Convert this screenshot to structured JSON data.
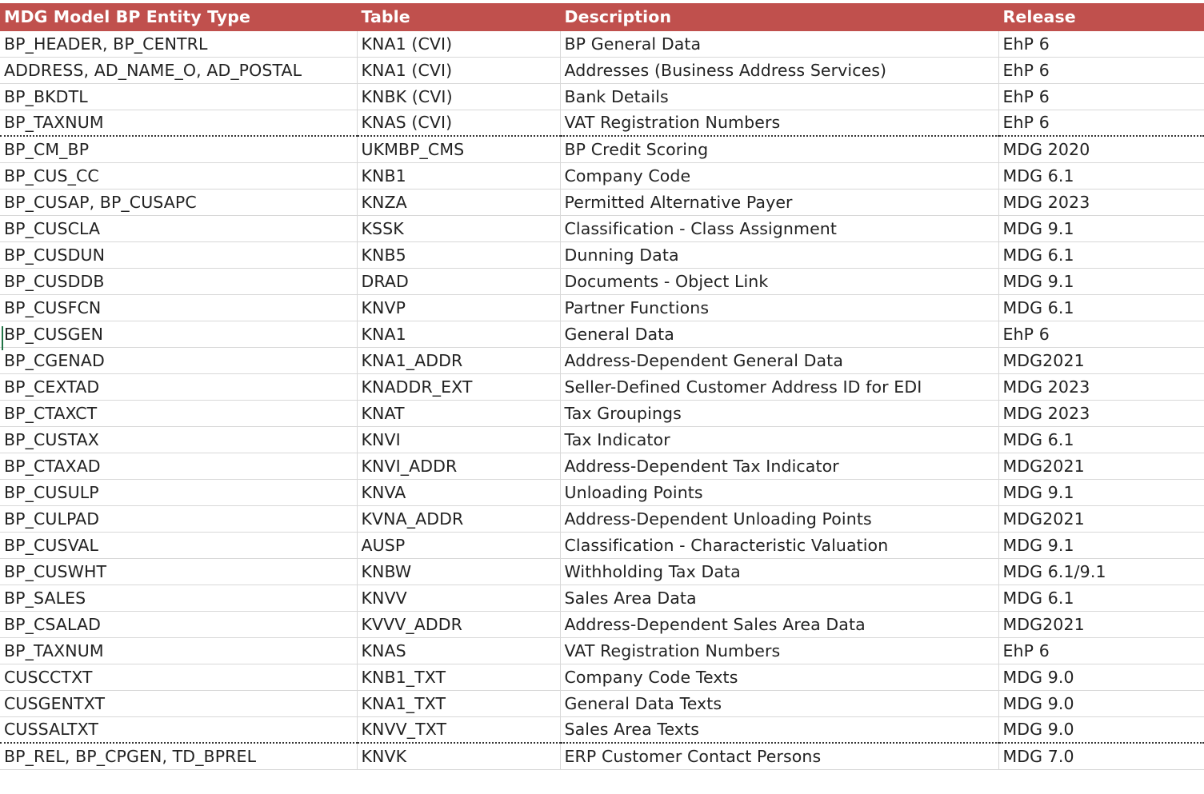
{
  "columns": [
    "MDG Model BP Entity Type",
    "Table",
    "Description",
    "Release"
  ],
  "rows": [
    {
      "entity": "BP_HEADER, BP_CENTRL",
      "table": "KNA1 (CVI)",
      "description": "BP General Data",
      "release": "EhP 6"
    },
    {
      "entity": "ADDRESS, AD_NAME_O, AD_POSTAL",
      "table": "KNA1 (CVI)",
      "description": "Addresses (Business Address Services)",
      "release": "EhP 6"
    },
    {
      "entity": "BP_BKDTL",
      "table": "KNBK (CVI)",
      "description": "Bank Details",
      "release": "EhP 6"
    },
    {
      "entity": "BP_TAXNUM",
      "table": "KNAS (CVI)",
      "description": "VAT Registration Numbers",
      "release": "EhP 6"
    },
    {
      "entity": "BP_CM_BP",
      "table": "UKMBP_CMS",
      "description": "BP Credit Scoring",
      "release": "MDG 2020"
    },
    {
      "entity": "BP_CUS_CC",
      "table": "KNB1",
      "description": "Company Code",
      "release": "MDG 6.1"
    },
    {
      "entity": "BP_CUSAP, BP_CUSAPC",
      "table": "KNZA",
      "description": "Permitted Alternative Payer",
      "release": "MDG 2023"
    },
    {
      "entity": "BP_CUSCLA",
      "table": "KSSK",
      "description": "Classification - Class Assignment",
      "release": "MDG 9.1"
    },
    {
      "entity": "BP_CUSDUN",
      "table": "KNB5",
      "description": "Dunning Data",
      "release": "MDG 6.1"
    },
    {
      "entity": "BP_CUSDDB",
      "table": "DRAD",
      "description": "Documents - Object Link",
      "release": "MDG 9.1"
    },
    {
      "entity": "BP_CUSFCN",
      "table": "KNVP",
      "description": "Partner Functions",
      "release": "MDG 6.1"
    },
    {
      "entity": "BP_CUSGEN",
      "table": "KNA1",
      "description": "General Data",
      "release": "EhP 6"
    },
    {
      "entity": "BP_CGENAD",
      "table": "KNA1_ADDR",
      "description": "Address-Dependent General Data",
      "release": "MDG2021"
    },
    {
      "entity": "BP_CEXTAD",
      "table": "KNADDR_EXT",
      "description": "Seller-Defined Customer Address ID for EDI",
      "release": "MDG 2023"
    },
    {
      "entity": "BP_CTAXCT",
      "table": "KNAT",
      "description": "Tax Groupings",
      "release": "MDG 2023"
    },
    {
      "entity": "BP_CUSTAX",
      "table": "KNVI",
      "description": "Tax Indicator",
      "release": "MDG 6.1"
    },
    {
      "entity": "BP_CTAXAD",
      "table": "KNVI_ADDR",
      "description": "Address-Dependent Tax Indicator",
      "release": "MDG2021"
    },
    {
      "entity": "BP_CUSULP",
      "table": "KNVA",
      "description": "Unloading Points",
      "release": "MDG 9.1"
    },
    {
      "entity": "BP_CULPAD",
      "table": "KVNA_ADDR",
      "description": "Address-Dependent Unloading Points",
      "release": "MDG2021"
    },
    {
      "entity": "BP_CUSVAL",
      "table": "AUSP",
      "description": "Classification - Characteristic Valuation",
      "release": "MDG 9.1"
    },
    {
      "entity": "BP_CUSWHT",
      "table": "KNBW",
      "description": "Withholding Tax Data",
      "release": "MDG 6.1/9.1"
    },
    {
      "entity": "BP_SALES",
      "table": "KNVV",
      "description": "Sales Area Data",
      "release": "MDG 6.1"
    },
    {
      "entity": "BP_CSALAD",
      "table": "KVVV_ADDR",
      "description": "Address-Dependent Sales Area Data",
      "release": "MDG2021"
    },
    {
      "entity": "BP_TAXNUM",
      "table": "KNAS",
      "description": "VAT Registration Numbers",
      "release": "EhP 6"
    },
    {
      "entity": "CUSCCTXT",
      "table": "KNB1_TXT",
      "description": "Company Code Texts",
      "release": "MDG 9.0"
    },
    {
      "entity": "CUSGENTXT",
      "table": "KNA1_TXT",
      "description": "General Data Texts",
      "release": "MDG 9.0"
    },
    {
      "entity": "CUSSALTXT",
      "table": "KNVV_TXT",
      "description": "Sales Area Texts",
      "release": "MDG 9.0"
    },
    {
      "entity": "BP_REL, BP_CPGEN, TD_BPREL",
      "table": "KNVK",
      "description": "ERP Customer Contact Persons",
      "release": "MDG 7.0"
    }
  ],
  "dotted_separator_after_rows": [
    3,
    26
  ],
  "colors": {
    "header_background": "#c0504d",
    "header_text": "#ffffff",
    "cell_text": "#222222",
    "gridline": "#d8d8d8"
  }
}
